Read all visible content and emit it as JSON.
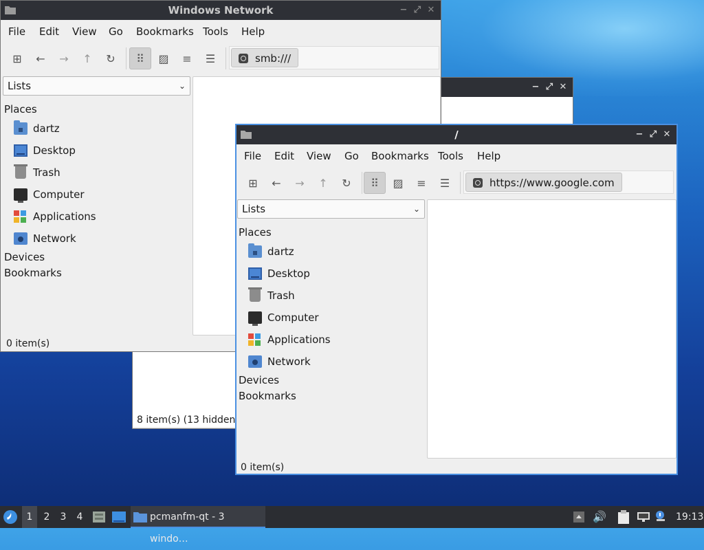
{
  "windows": {
    "network": {
      "title": "Windows Network",
      "menu": [
        "File",
        "Edit",
        "View",
        "Go",
        "Bookmarks",
        "Tools",
        "Help"
      ],
      "address": "smb:///",
      "lists": "Lists",
      "places_header": "Places",
      "places": [
        "dartz",
        "Desktop",
        "Trash",
        "Computer",
        "Applications",
        "Network"
      ],
      "devices": "Devices",
      "bookmarks": "Bookmarks",
      "status": "0 item(s)"
    },
    "middle": {
      "status": "8 item(s) (13 hidden)"
    },
    "root": {
      "title": "/",
      "menu": [
        "File",
        "Edit",
        "View",
        "Go",
        "Bookmarks",
        "Tools",
        "Help"
      ],
      "address": "https://www.google.com",
      "lists": "Lists",
      "places_header": "Places",
      "places": [
        "dartz",
        "Desktop",
        "Trash",
        "Computer",
        "Applications",
        "Network"
      ],
      "devices": "Devices",
      "bookmarks": "Bookmarks",
      "status": "0 item(s)"
    }
  },
  "taskbar": {
    "workspaces": [
      "1",
      "2",
      "3",
      "4"
    ],
    "task_label": "pcmanfm-qt - 3 windo…",
    "clock": "19:13"
  }
}
